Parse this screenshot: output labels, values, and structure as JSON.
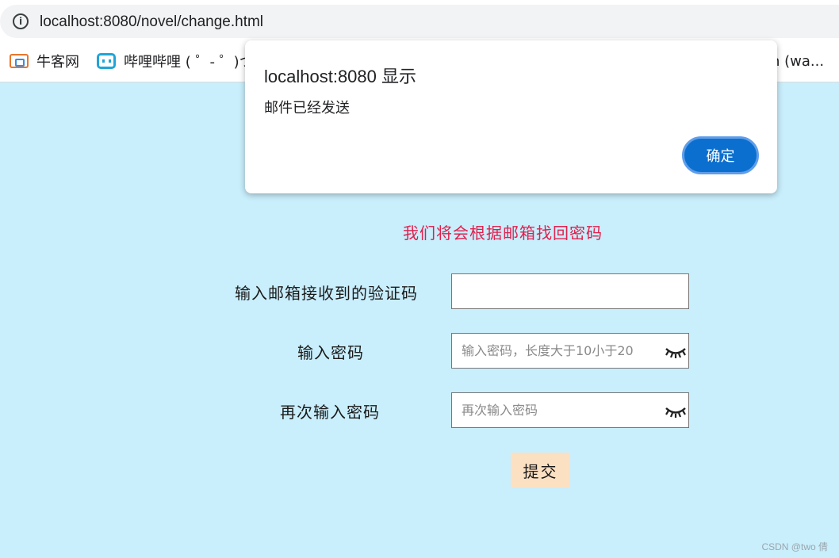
{
  "browser": {
    "url": "localhost:8080/novel/change.html",
    "bookmarks": [
      {
        "label": "牛客网",
        "icon": "nowcoder-icon"
      },
      {
        "label": "哔哩哔哩 ( ゜- ゜)つ",
        "icon": "bilibili-icon"
      },
      {
        "label": "n (wa..."
      }
    ]
  },
  "page": {
    "heading": "我们将会根据邮箱找回密码",
    "fields": {
      "code_label": "输入邮箱接收到的验证码",
      "code_value": "",
      "password_label": "输入密码",
      "password_placeholder": "输入密码，长度大于10小于20",
      "confirm_label": "再次输入密码",
      "confirm_placeholder": "再次输入密码"
    },
    "submit_label": "提交",
    "watermark": "CSDN @two 倩"
  },
  "dialog": {
    "title": "localhost:8080 显示",
    "message": "邮件已经发送",
    "ok_label": "确定"
  },
  "colors": {
    "page_background": "#c9eefc",
    "heading": "#e0204d",
    "submit_background": "#fbe0c2",
    "dialog_button": "#0b6fcf"
  }
}
